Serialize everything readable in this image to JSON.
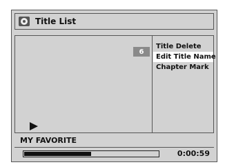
{
  "header": {
    "icon": "disc-icon",
    "title": "Title List"
  },
  "preview": {
    "title_number": "6",
    "play_icon": "play-icon"
  },
  "menu": {
    "items": [
      {
        "label": "Title Delete",
        "selected": false
      },
      {
        "label": "Edit Title Name",
        "selected": true
      },
      {
        "label": "Chapter Mark",
        "selected": false
      }
    ]
  },
  "title_name": "MY FAVORITE",
  "playback": {
    "progress_fraction": 0.5,
    "time": "0:00:59"
  }
}
